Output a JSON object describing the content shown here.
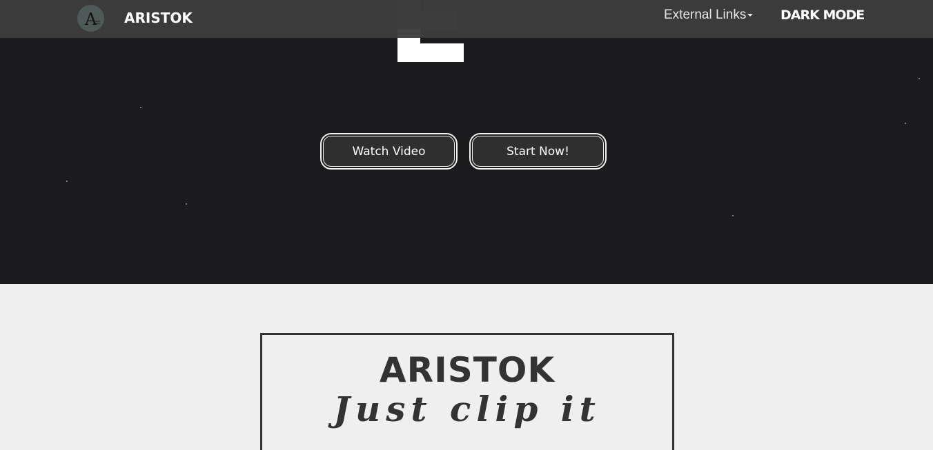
{
  "navbar": {
    "logo_glyph": "A",
    "brand": "ARISTOK",
    "external_links": "External Links",
    "dark_mode": "DARK MODE"
  },
  "hero": {
    "watch_video": "Watch Video",
    "start_now": "Start Now!"
  },
  "brand_box": {
    "title": "ARISTOK",
    "tagline": "Just clip it"
  },
  "colors": {
    "hero_bg": "#1b1a1d",
    "navbar_bg": "#3c3c3c",
    "page_bg": "#efefef",
    "text_dark": "#333333"
  }
}
